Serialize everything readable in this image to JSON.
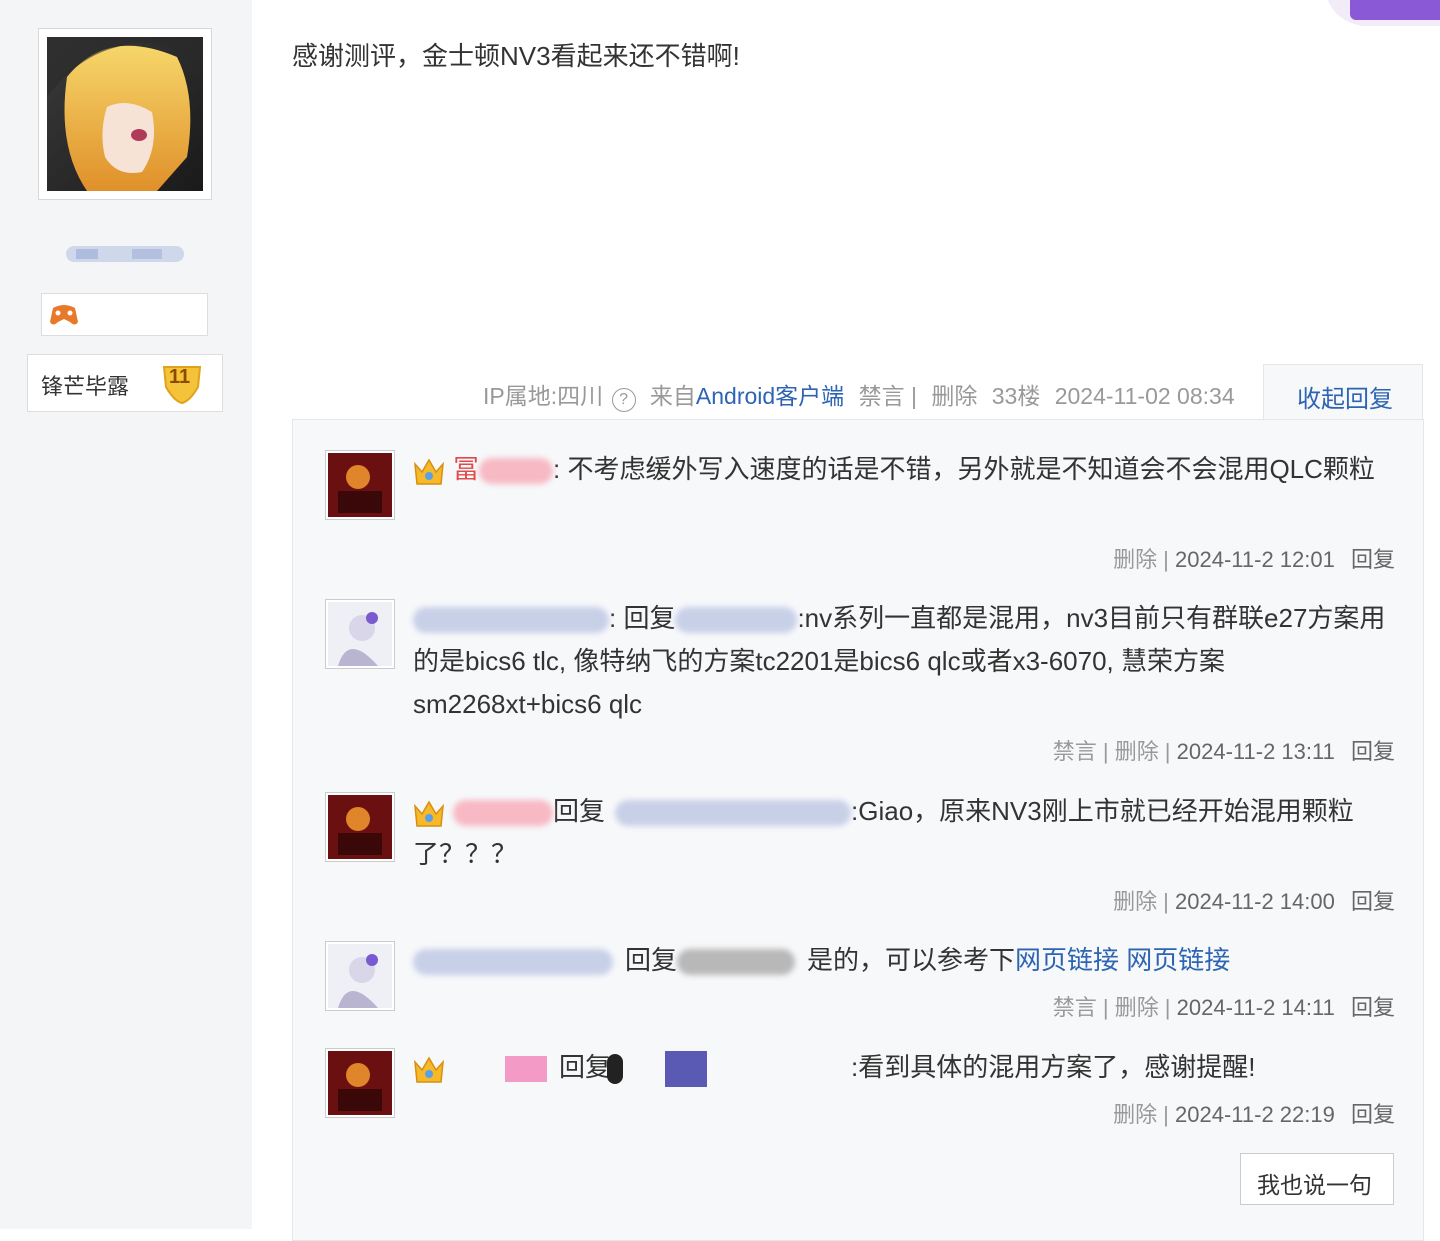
{
  "author": {
    "rank_title": "锋芒毕露",
    "rank_level": "11"
  },
  "post": {
    "content": "感谢测评，金士顿NV3看起来还不错啊!",
    "ip_location": "IP属地:四川",
    "source_prefix": "来自",
    "source_client": "Android客户端",
    "mute_label": "禁言 |",
    "delete_label": "删除",
    "floor": "33楼",
    "datetime": "2024-11-02 08:34",
    "collapse_label": "收起回复"
  },
  "replies": [
    {
      "name_visible": "冨",
      "text": ": 不考虑缓外写入速度的话是不错，另外就是不知道会不会混用QLC颗粒",
      "actions": "删除 |",
      "time": "2024-11-2 12:01",
      "reply_label": "回复"
    },
    {
      "reply_word": ": 回复",
      "text": ":nv系列一直都是混用，nv3目前只有群联e27方案用的是bics6 tlc, 像特纳飞的方案tc2201是bics6 qlc或者x3-6070, 慧荣方案sm2268xt+bics6 qlc",
      "actions": "禁言 | 删除 |",
      "time": "2024-11-2 13:11",
      "reply_label": "回复"
    },
    {
      "reply_word": "回复",
      "text": ":Giao，原来NV3刚上市就已经开始混用颗粒了？？？",
      "actions": "删除 |",
      "time": "2024-11-2 14:00",
      "reply_label": "回复"
    },
    {
      "reply_word": "回复",
      "text": "是的，可以参考下",
      "link1": "网页链接",
      "link2": "网页链接",
      "actions": "禁言 | 删除 |",
      "time": "2024-11-2 14:11",
      "reply_label": "回复"
    },
    {
      "reply_word": "回复",
      "text": ":看到具体的混用方案了，感谢提醒!",
      "actions": "删除 |",
      "time": "2024-11-2 22:19",
      "reply_label": "回复"
    }
  ],
  "say_button": "我也说一句",
  "colors": {
    "link": "#2d64b3",
    "meta": "#999999",
    "panel": "#f7f8fa"
  }
}
